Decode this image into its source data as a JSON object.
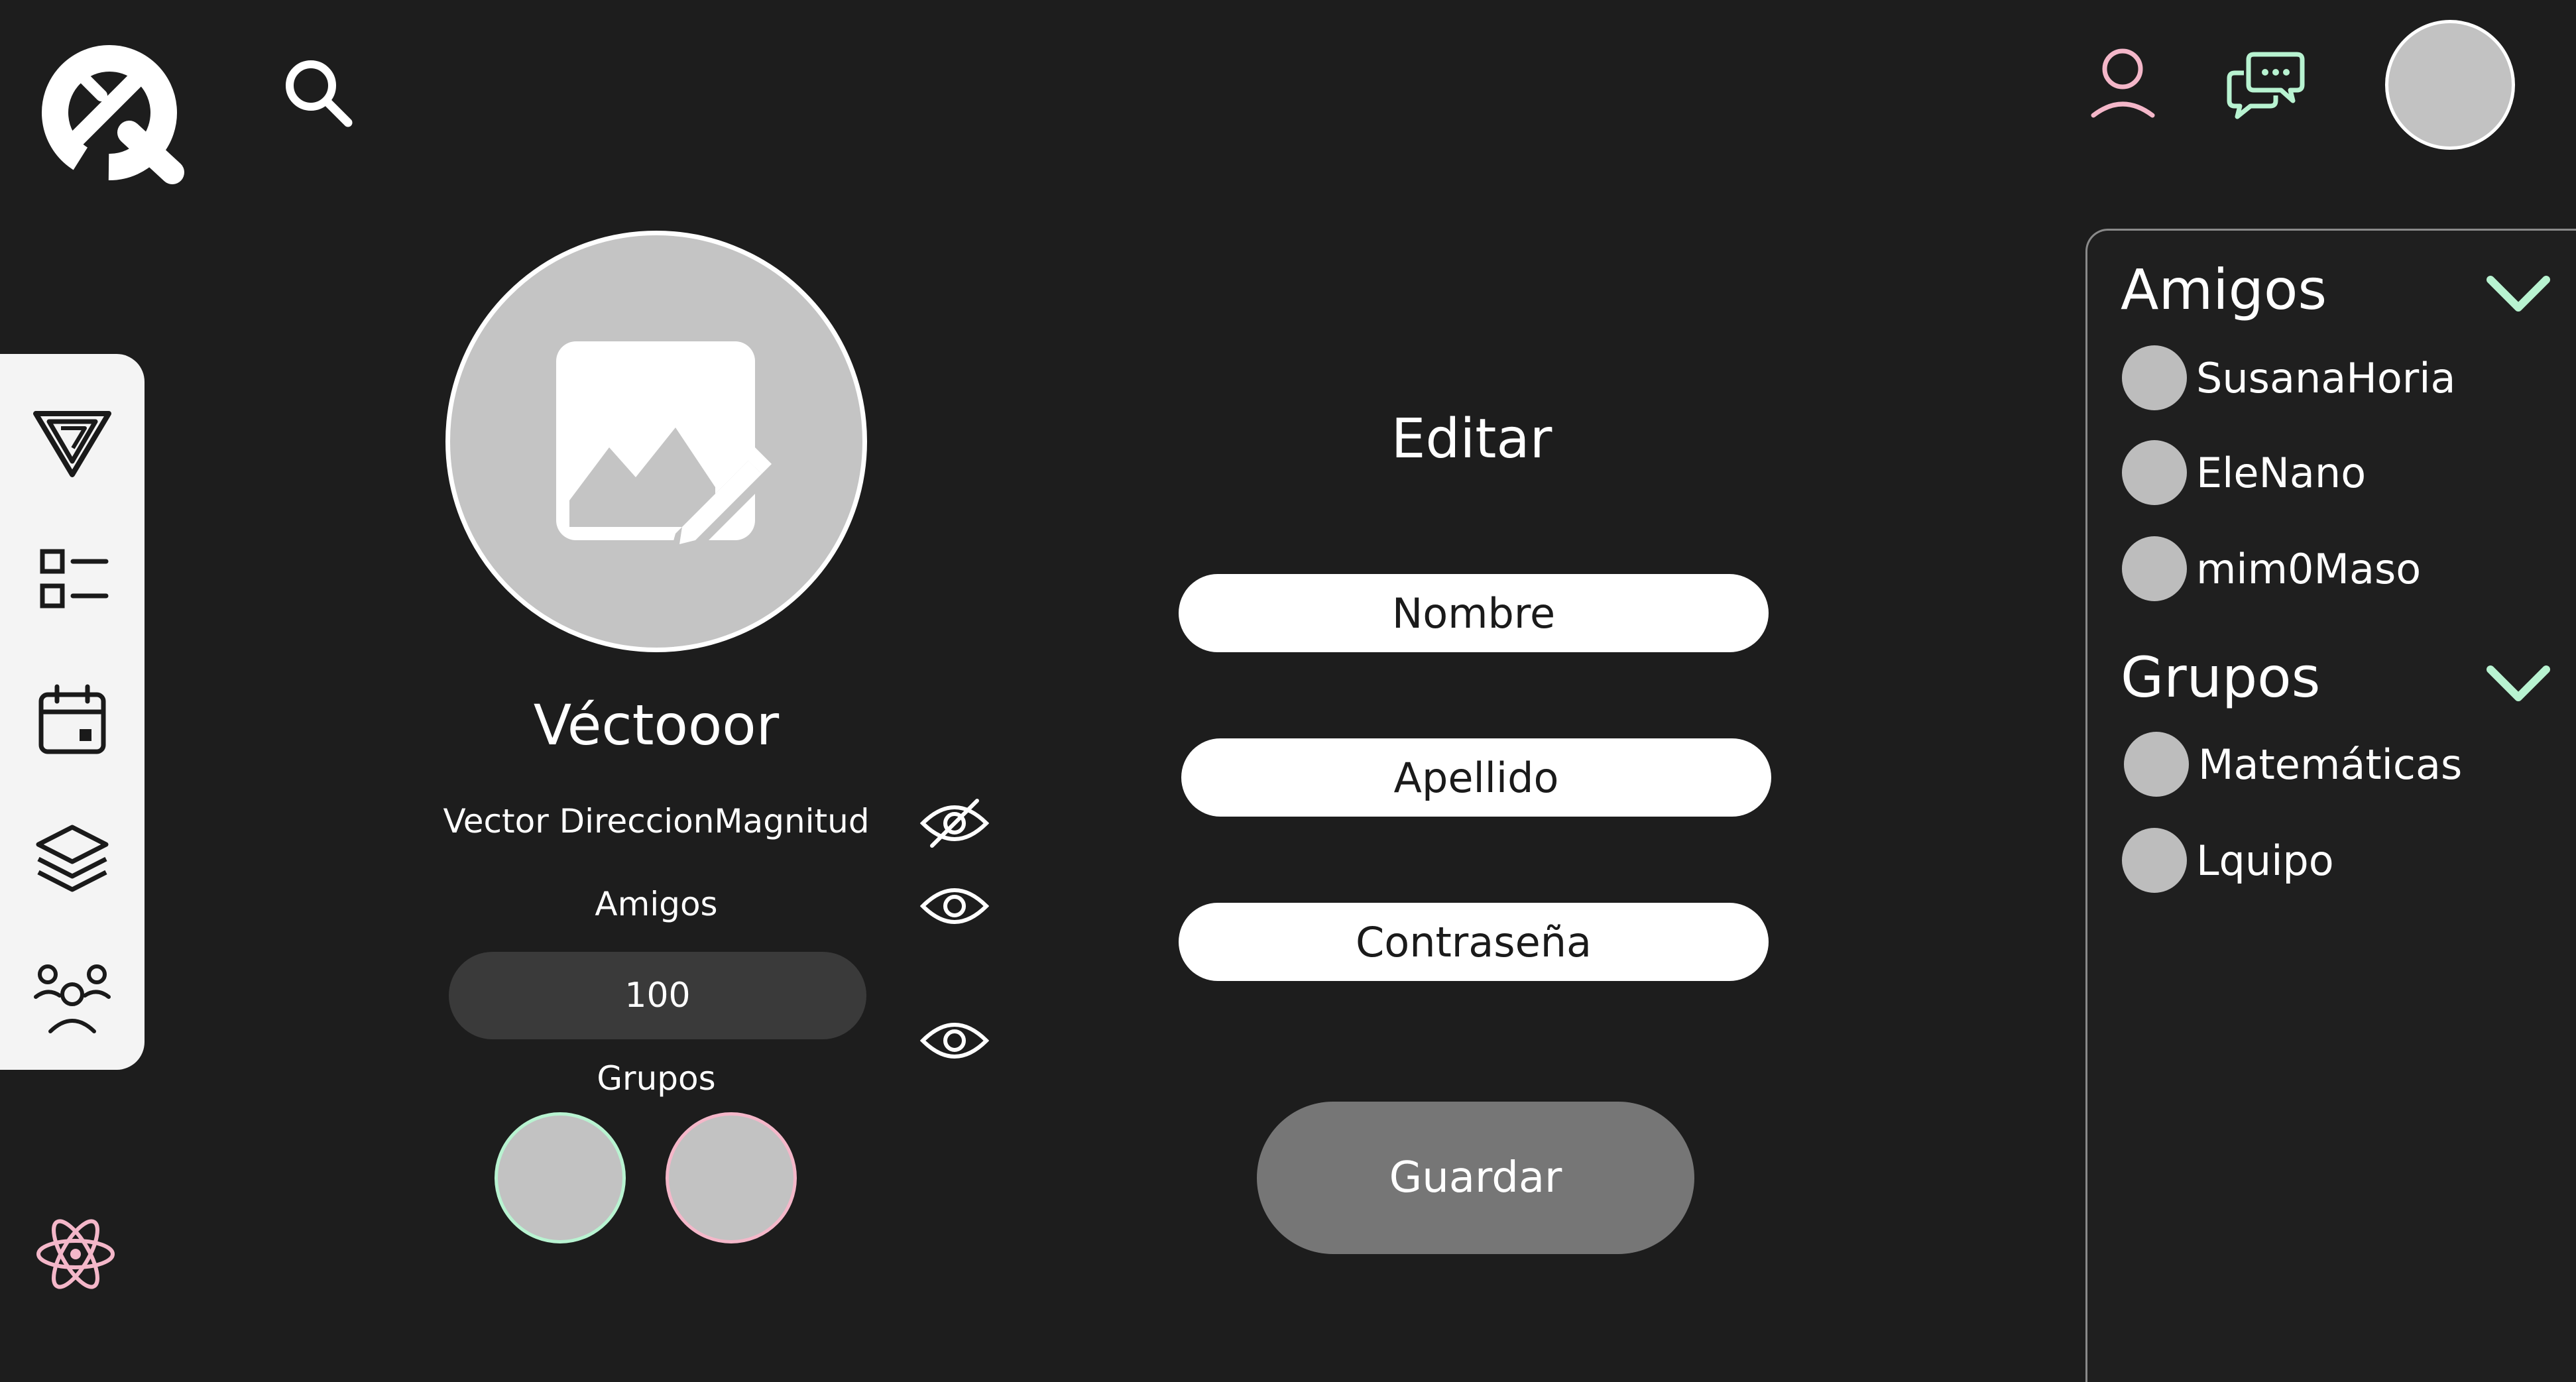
{
  "header": {
    "logo_icon": "app-logo",
    "search_icon": "search-icon",
    "user_icon": "user-icon",
    "chat_icon": "chat-bubbles-icon",
    "avatar_icon": "avatar"
  },
  "toolbar": {
    "items": [
      {
        "icon": "triangle-logo-icon"
      },
      {
        "icon": "list-icon"
      },
      {
        "icon": "calendar-icon"
      },
      {
        "icon": "layers-icon"
      },
      {
        "icon": "people-icon"
      }
    ],
    "bottom_icon": "atom-icon"
  },
  "profile": {
    "username": "Véctooor",
    "fullname": "Vector DireccionMagnitud",
    "friends_label": "Amigos",
    "friends_count": "100",
    "groups_label": "Grupos"
  },
  "edit": {
    "title": "Editar",
    "fields": [
      "Nombre",
      "Apellido",
      "Contraseña"
    ],
    "save_label": "Guardar"
  },
  "sidebar": {
    "friends_title": "Amigos",
    "friends": [
      "SusanaHoria",
      "EleNano",
      "mim0Maso"
    ],
    "groups_title": "Grupos",
    "groups": [
      "Matemáticas",
      "Lquipo"
    ]
  },
  "colors": {
    "background": "#1d1d1d",
    "accent_green": "#b8f3d1",
    "accent_pink": "#f4b7c9",
    "button": "#767676"
  }
}
